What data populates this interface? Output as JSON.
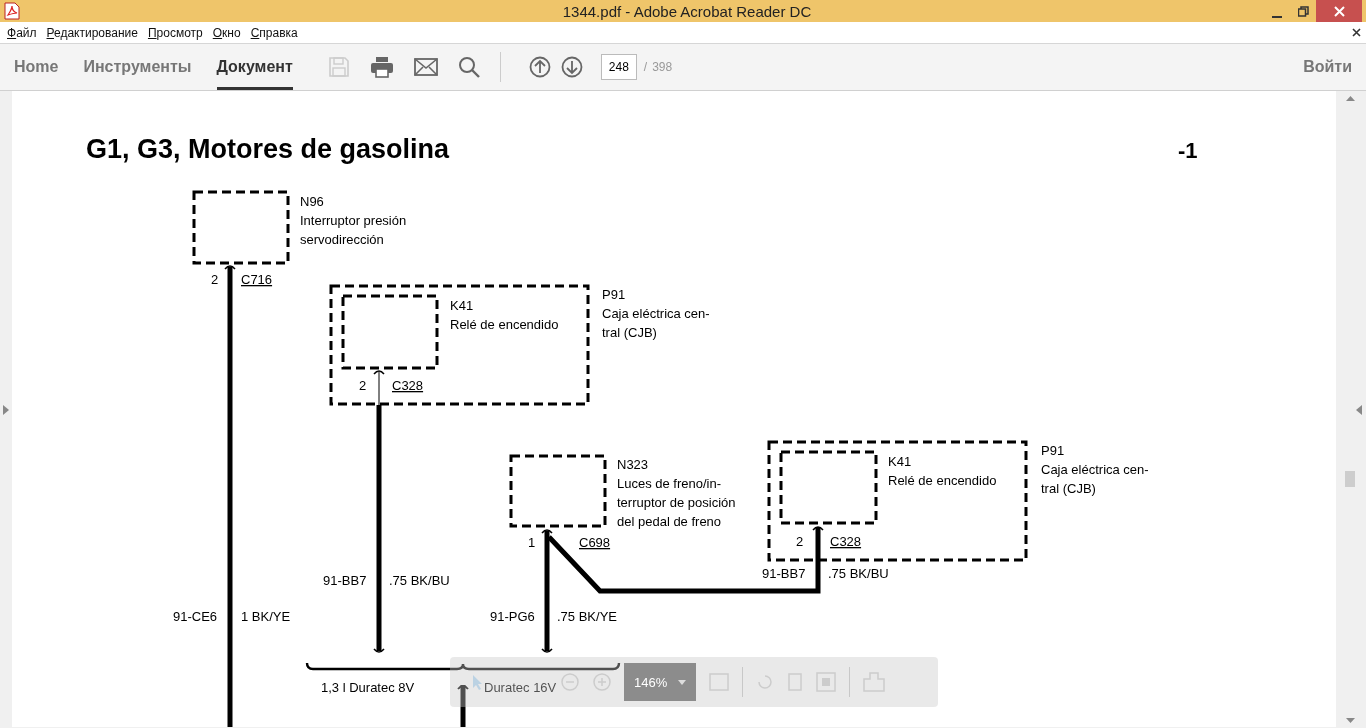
{
  "window": {
    "title": "1344.pdf - Adobe Acrobat Reader DC"
  },
  "menu": [
    {
      "label": "Файл"
    },
    {
      "label": "Редактирование"
    },
    {
      "label": "Просмотр"
    },
    {
      "label": "Окно"
    },
    {
      "label": "Справка"
    }
  ],
  "tabs": [
    {
      "label": "Home",
      "selected": false
    },
    {
      "label": "Инструменты",
      "selected": false
    },
    {
      "label": "Документ",
      "selected": true
    }
  ],
  "page_field": {
    "value": "248",
    "separator": "/",
    "total": "398"
  },
  "sign_in": "Войти",
  "document": {
    "title": "G1, G3, Motores de gasolina",
    "page_label": "-1",
    "components": [
      {
        "code": "N96",
        "lines": [
          "Interruptor presión",
          "servodirección"
        ]
      },
      {
        "code": "K41",
        "lines": [
          "Relé de encendido"
        ]
      },
      {
        "code": "P91",
        "lines": [
          "Caja eléctrica cen-",
          "tral (CJB)"
        ]
      },
      {
        "code": "N323",
        "lines": [
          "Luces de freno/in-",
          "terruptor de posición",
          "del pedal de freno"
        ]
      },
      {
        "code": "K41",
        "lines": [
          "Relé de encendido"
        ]
      },
      {
        "code": "P91",
        "lines": [
          "Caja eléctrica cen-",
          "tral (CJB)"
        ]
      }
    ],
    "pins": [
      {
        "pin": "2",
        "connector": "C716"
      },
      {
        "pin": "2",
        "connector": "C328"
      },
      {
        "pin": "1",
        "connector": "C698"
      },
      {
        "pin": "2",
        "connector": "C328"
      }
    ],
    "wires": [
      {
        "circuit": "91-CE6",
        "spec": "1 BK/YE"
      },
      {
        "circuit": "91-BB7",
        "spec": ".75 BK/BU"
      },
      {
        "circuit": "91-PG6",
        "spec": ".75 BK/YE"
      },
      {
        "circuit": "91-BB7",
        "spec": ".75 BK/BU"
      }
    ],
    "variants": [
      "1,3 l Duratec 8V",
      "Duratec 16V"
    ]
  },
  "float_toolbar": {
    "zoom": "146%"
  }
}
